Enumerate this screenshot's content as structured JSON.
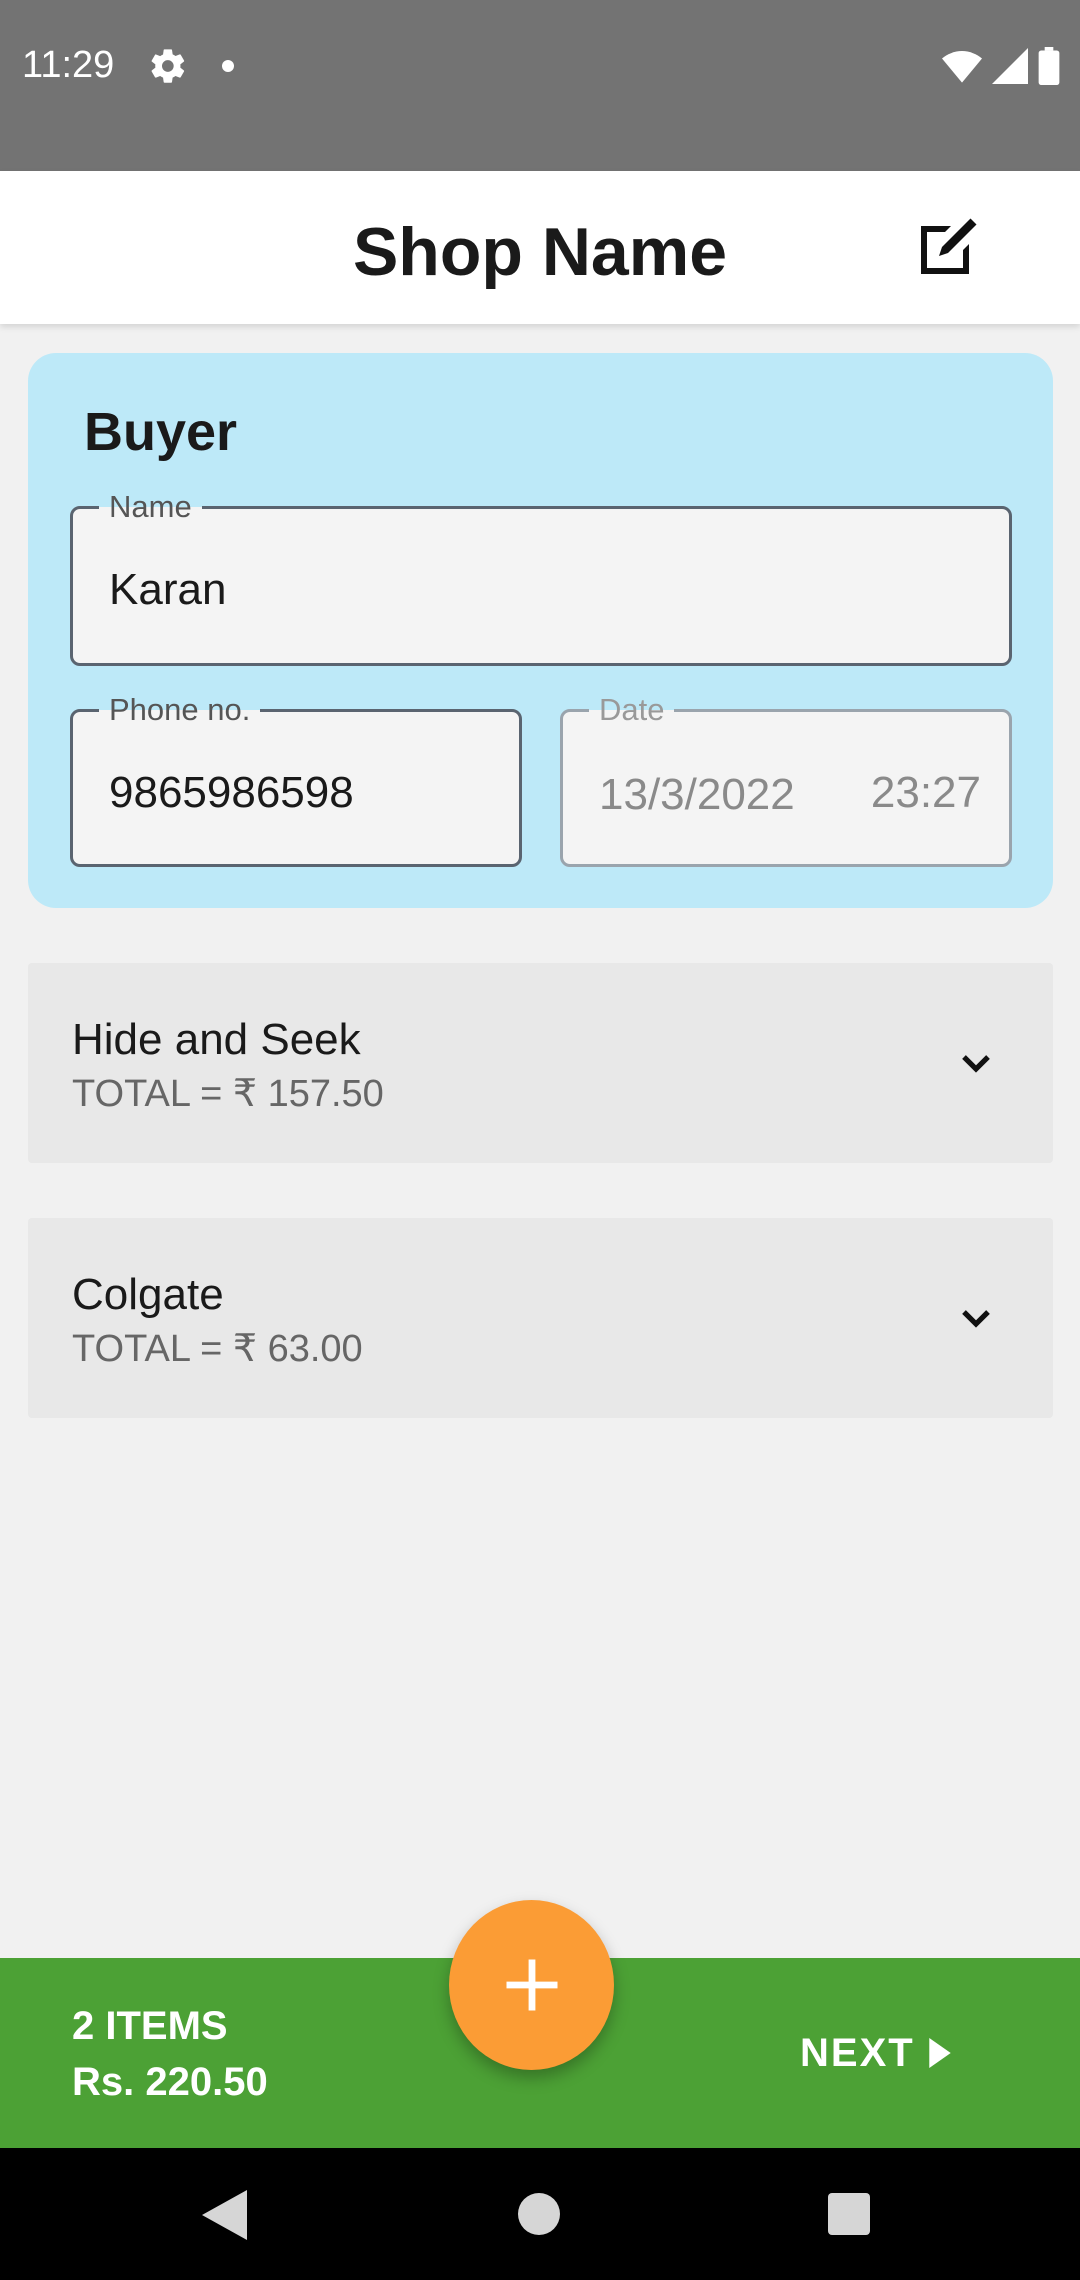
{
  "status_bar": {
    "time": "11:29",
    "icons": [
      "settings-gear-icon",
      "notification-dot",
      "wifi-icon",
      "signal-icon",
      "battery-icon"
    ]
  },
  "app_bar": {
    "title": "Shop Name",
    "edit_icon": "edit-icon"
  },
  "buyer": {
    "heading": "Buyer",
    "name_label": "Name",
    "name_value": "Karan",
    "phone_label": "Phone no.",
    "phone_value": "9865986598",
    "date_label": "Date",
    "date_value": "13/3/2022",
    "time_value": "23:27"
  },
  "items": [
    {
      "name": "Hide and Seek",
      "total": "TOTAL = ₹ 157.50"
    },
    {
      "name": "Colgate",
      "total": "TOTAL = ₹ 63.00"
    }
  ],
  "bottom_bar": {
    "count": "2 ITEMS",
    "amount": "Rs. 220.50",
    "next_label": "NEXT"
  },
  "colors": {
    "status_bar": "#737373",
    "buyer_card": "#bde9f8",
    "bottom_bar": "#4ca135",
    "fab": "#fb9c35"
  }
}
